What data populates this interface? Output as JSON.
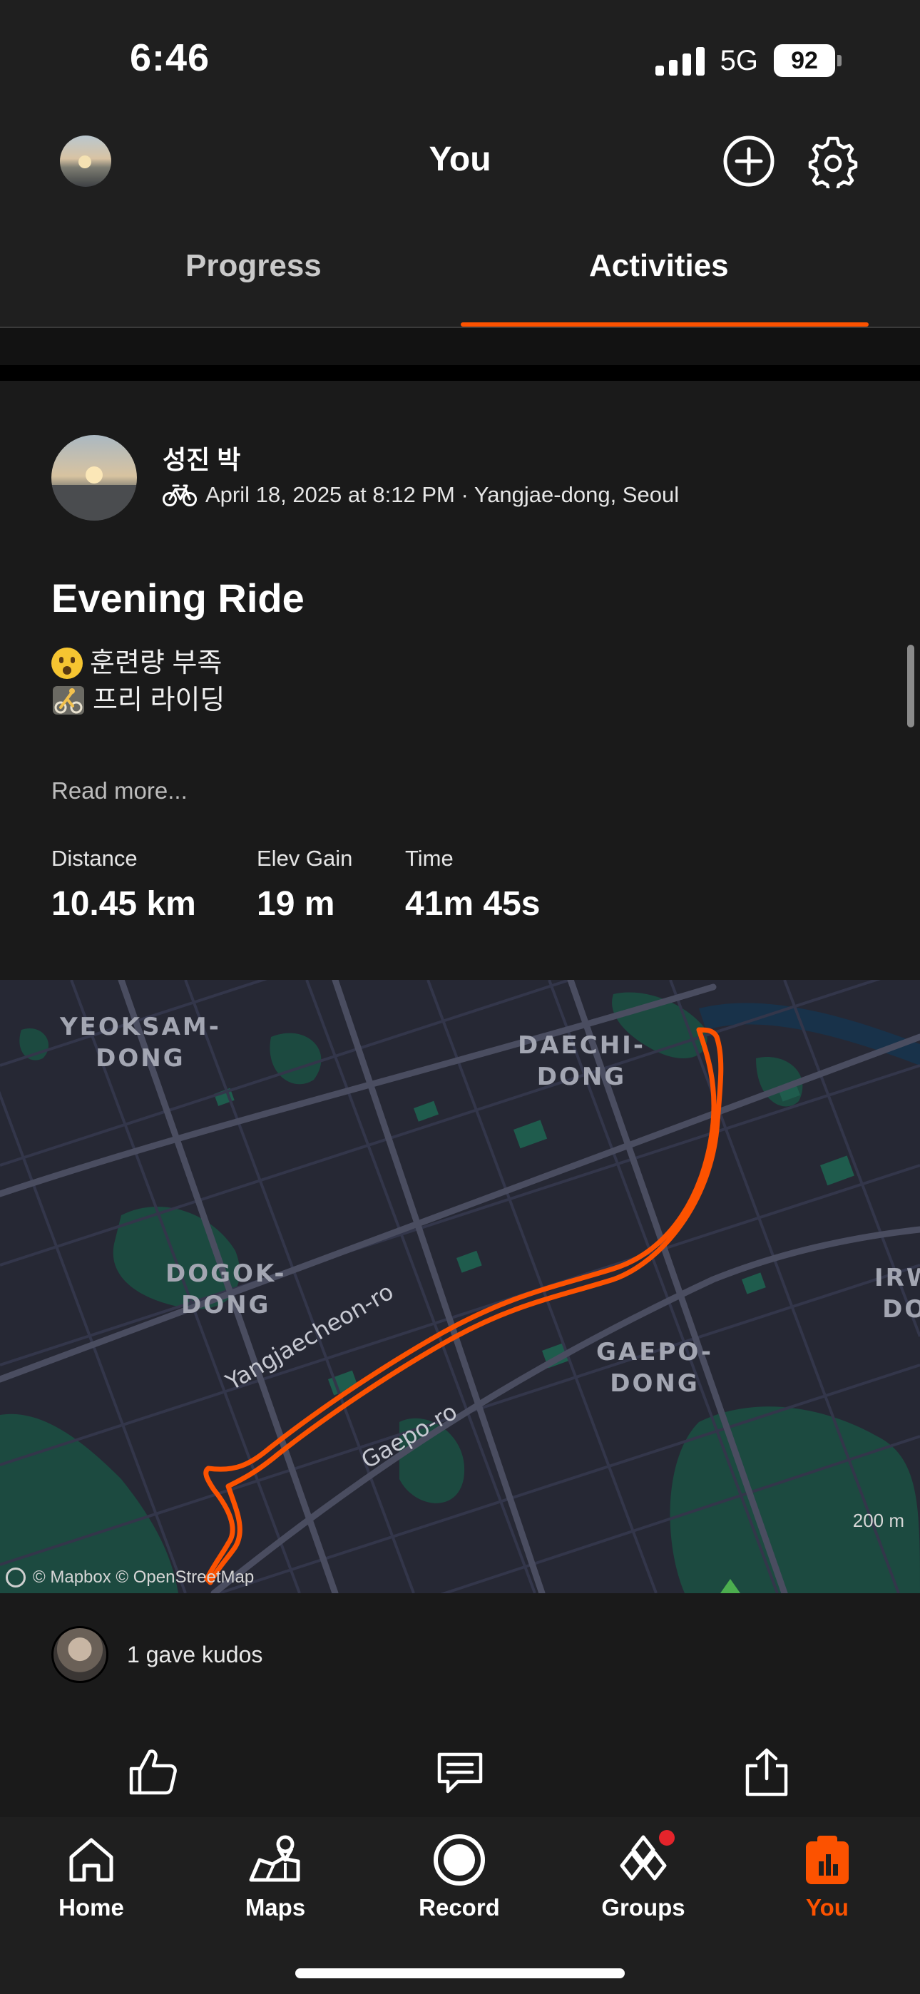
{
  "status_bar": {
    "time": "6:46",
    "network": "5G",
    "battery": "92"
  },
  "header": {
    "title": "You"
  },
  "tabs": [
    {
      "label": "Progress",
      "active": false
    },
    {
      "label": "Activities",
      "active": true
    }
  ],
  "activity": {
    "athlete_name": "성진 박",
    "date_location": "April 18, 2025 at 8:12 PM · Yangjae-dong, Seoul",
    "title": "Evening Ride",
    "description": [
      "훈련량 부족",
      "프리 라이딩"
    ],
    "read_more": "Read more...",
    "stats": [
      {
        "label": "Distance",
        "value": "10.45 km"
      },
      {
        "label": "Elev Gain",
        "value": "19 m"
      },
      {
        "label": "Time",
        "value": "41m 45s"
      }
    ]
  },
  "map": {
    "districts": [
      "YEOKSAM-\nDONG",
      "DAECHI-\nDONG",
      "DOGOK-\nDONG",
      "GAEPO-\nDONG",
      "IRW\nDO"
    ],
    "roads": [
      "Yangjaecheon-ro",
      "Gaepo-ro"
    ],
    "attribution": "© Mapbox © OpenStreetMap",
    "scale": "200 m",
    "route_color": "#fc5200"
  },
  "social": {
    "kudos_text": "1 gave kudos"
  },
  "bottom_nav": [
    {
      "label": "Home",
      "icon": "home-icon"
    },
    {
      "label": "Maps",
      "icon": "map-icon"
    },
    {
      "label": "Record",
      "icon": "record-icon"
    },
    {
      "label": "Groups",
      "icon": "groups-icon"
    },
    {
      "label": "You",
      "icon": "you-icon",
      "active": true
    }
  ],
  "colors": {
    "accent": "#fc5200",
    "background": "#121212",
    "card": "#1a1a1a",
    "bar": "#1f1f1f"
  }
}
